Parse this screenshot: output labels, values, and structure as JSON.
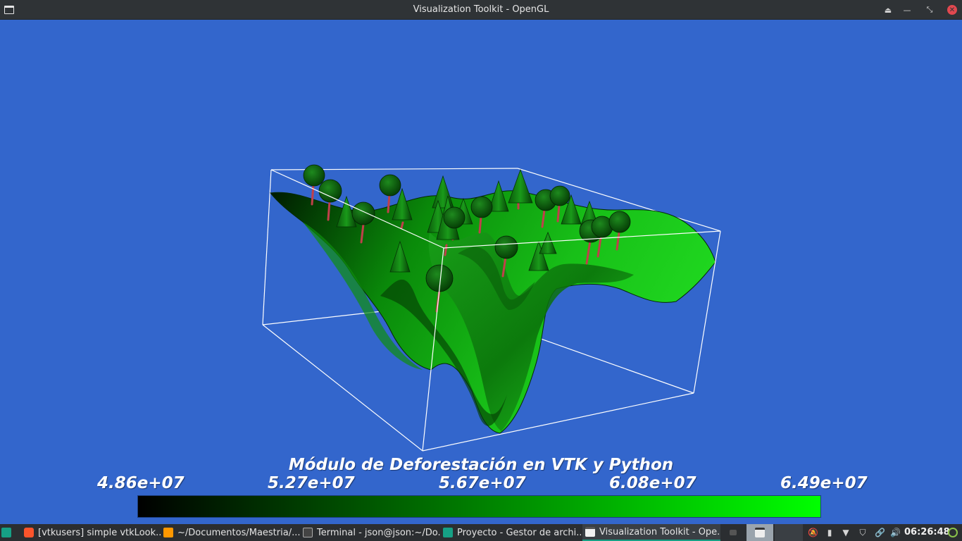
{
  "window": {
    "title": "Visualization Toolkit - OpenGL",
    "controls": [
      "keep-above",
      "minimize",
      "restore",
      "close"
    ]
  },
  "scene": {
    "background": "#3366cc",
    "title": "Módulo de Deforestación en VTK y Python",
    "colorbar": {
      "ticks": [
        "4.86e+07",
        "5.27e+07",
        "5.67e+07",
        "6.08e+07",
        "6.49e+07"
      ],
      "color_low": "#000000",
      "color_high": "#00ff00"
    },
    "terrain_color": "#11b011",
    "tree_color": "#0b6a0b",
    "trunk_color": "#c0404a",
    "bounding_box_color": "#ffffff"
  },
  "taskbar": {
    "accent": "#16a085",
    "tasks": [
      {
        "icon": "brave-browser-icon",
        "label": "[vtkusers] simple vtkLook..."
      },
      {
        "icon": "sublime-text-icon",
        "label": "~/Documentos/Maestria/..."
      },
      {
        "icon": "terminal-icon",
        "label": "Terminal - json@json:~/Do..."
      },
      {
        "icon": "folder-icon",
        "label": "Proyecto - Gestor de archi..."
      },
      {
        "icon": "window-icon",
        "label": "Visualization Toolkit - Ope..."
      }
    ],
    "clock": "06:26:48"
  }
}
